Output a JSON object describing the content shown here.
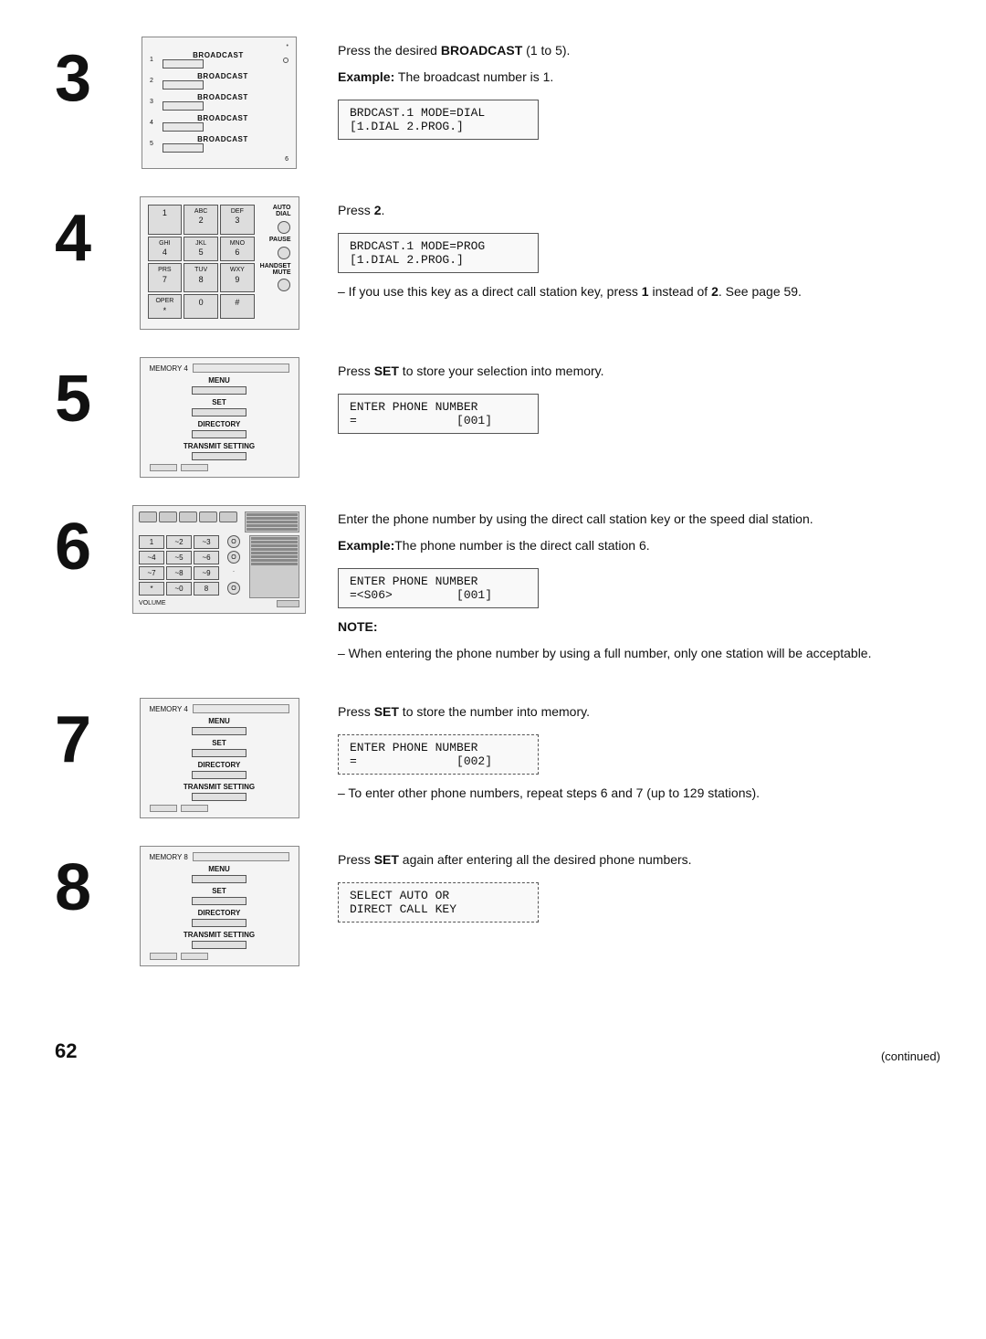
{
  "page": {
    "number": "62",
    "continued": "(continued)"
  },
  "steps": [
    {
      "id": "3",
      "text_main": "Press the desired BROADCAST (1 to 5).",
      "example_label": "Example:",
      "example_text": " The broadcast number is 1.",
      "lcd_boxes": [
        {
          "lines": [
            "BRDCAST.1 MODE=DIAL",
            "[1.DIAL 2.PROG.]"
          ],
          "dashed": false
        }
      ]
    },
    {
      "id": "4",
      "text_main": "Press 2.",
      "lcd_boxes": [
        {
          "lines": [
            "BRDCAST.1 MODE=PROG",
            "[1.DIAL 2.PROG.]"
          ],
          "dashed": false
        }
      ],
      "note_text": "– If you use this key as a direct call station key, press 1 instead of 2. See page 59."
    },
    {
      "id": "5",
      "text_main": "Press SET to store your selection into memory.",
      "lcd_boxes": [
        {
          "lines": [
            "ENTER PHONE NUMBER",
            "=              [001]"
          ],
          "dashed": false
        }
      ]
    },
    {
      "id": "6",
      "text_main": "Enter the phone number by using the direct call station key or the speed dial station.",
      "example_label": "Example:",
      "example_text": "The phone number is the direct call station 6.",
      "lcd_boxes": [
        {
          "lines": [
            "ENTER PHONE NUMBER",
            "=<S06>         [001]"
          ],
          "dashed": false
        }
      ],
      "note_label": "NOTE:",
      "note_detail": "– When entering the phone number by using a full number, only one station will be acceptable."
    },
    {
      "id": "7",
      "text_main": "Press SET to store the number into memory.",
      "lcd_boxes": [
        {
          "lines": [
            "ENTER PHONE NUMBER",
            "=              [002]"
          ],
          "dashed": true
        }
      ],
      "note_text": "– To enter other phone numbers, repeat steps 6 and 7 (up to 129 stations)."
    },
    {
      "id": "8",
      "text_main": "Press SET again after entering all the desired phone numbers.",
      "lcd_boxes": [
        {
          "lines": [
            "SELECT AUTO OR",
            "DIRECT CALL KEY"
          ],
          "dashed": true
        }
      ]
    }
  ],
  "broadcast_panel": {
    "rows": [
      {
        "num": "1",
        "label": "BROADCAST"
      },
      {
        "num": "2",
        "label": "BROADCAST"
      },
      {
        "num": "3",
        "label": "BROADCAST"
      },
      {
        "num": "4",
        "label": "BROADCAST"
      },
      {
        "num": "5",
        "label": "BROADCAST"
      }
    ]
  },
  "keypad": {
    "keys": [
      {
        "main": "1",
        "sub": ""
      },
      {
        "main": "2",
        "sub": "ABC"
      },
      {
        "main": "3",
        "sub": "DEF"
      },
      {
        "main": "",
        "sub": "AUTO DIAL"
      },
      {
        "main": "4",
        "sub": "GHI"
      },
      {
        "main": "5",
        "sub": "JKL"
      },
      {
        "main": "6",
        "sub": "MNO"
      },
      {
        "main": "",
        "sub": "PAUSE"
      },
      {
        "main": "7",
        "sub": "PRS"
      },
      {
        "main": "8",
        "sub": "TUV"
      },
      {
        "main": "9",
        "sub": "WXY"
      },
      {
        "main": "",
        "sub": "HANDSET MUTE"
      },
      {
        "main": "*",
        "sub": "OPER"
      },
      {
        "main": "0",
        "sub": ""
      },
      {
        "main": "#",
        "sub": ""
      }
    ]
  },
  "menu_panel": {
    "labels": [
      "MENU",
      "SET",
      "DIRECTORY",
      "TRANSMIT SETTING"
    ]
  }
}
